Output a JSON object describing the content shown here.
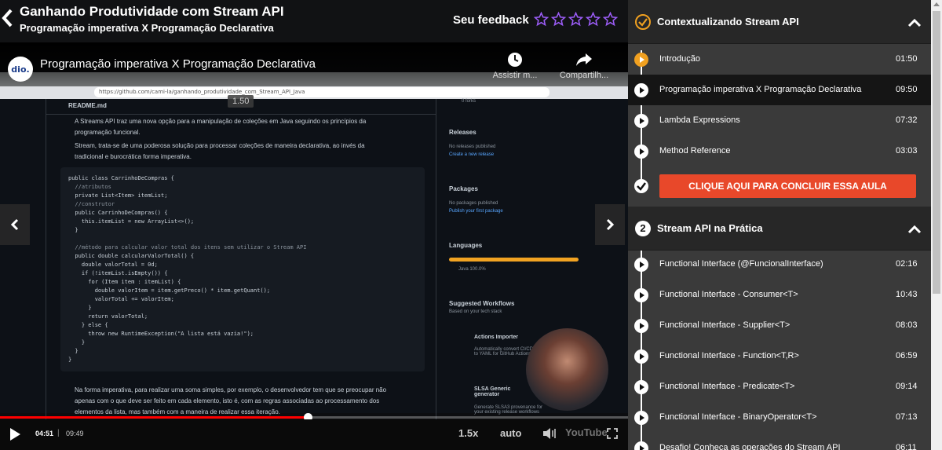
{
  "header": {
    "course_title": "Ganhando Produtividade com Stream API",
    "lesson_subtitle": "Programação imperativa X Programação Declarativa",
    "feedback_label": "Seu feedback",
    "star_count": 5,
    "accent_color": "#9b5cf6"
  },
  "player": {
    "channel_avatar_text": "dio.",
    "video_title": "Programação imperativa X Programação Declarativa",
    "watch_later_label": "Assistir m...",
    "share_label": "Compartilh...",
    "speed_badge": "1.50",
    "current_time": "04:51",
    "time_separator": "|",
    "total_time": "09:49",
    "progress": 0.49,
    "speed": "1.5x",
    "quality": "auto",
    "logo_text": "YouTube"
  },
  "screen": {
    "url": "https://github.com/cami-la/ganhando_produtividade_com_Stream_API_Java",
    "readme_name": "README.md",
    "bullets": [
      "A Streams API traz uma nova opção para a manipulação de coleções em Java seguindo os princípios da",
      "programação funcional.",
      "Stream, trata-se de uma poderosa solução para processar coleções de maneira declarativa, ao invés da",
      "tradicional e burocrática forma imperativa."
    ],
    "code": [
      "public class CarrinhoDeCompras {",
      "  //atributos",
      "  private List<Item> itemList;",
      "  //construtor",
      "  public CarrinhoDeCompras() {",
      "    this.itemList = new ArrayList<>();",
      "  }",
      "",
      "  //método para calcular valor total dos itens sem utilizar o Stream API",
      "  public double calcularValorTotal() {",
      "    double valorTotal = 0d;",
      "    if (!itemList.isEmpty()) {",
      "      for (Item item : itemList) {",
      "        double valorItem = item.getPreco() * item.getQuant();",
      "        valorTotal += valorItem;",
      "      }",
      "      return valorTotal;",
      "    } else {",
      "      throw new RuntimeException(\"A lista está vazia!\");",
      "    }",
      "  }",
      "}"
    ],
    "after_text": [
      "Na forma imperativa, para realizar uma soma simples, por exemplo, o desenvolvedor tem que se preocupar não",
      "apenas com o que deve ser feito em cada elemento, isto é, com as regras associadas ao processamento dos",
      "elementos da lista, mas também com a maneira de realizar essa iteração."
    ],
    "forks": "0 forks",
    "releases_title": "Releases",
    "releases_text": "No releases published",
    "releases_link": "Create a new release",
    "packages_title": "Packages",
    "packages_text": "No packages published",
    "packages_link": "Publish your first package",
    "languages_title": "Languages",
    "language": "Java 100.0%",
    "workflows_title": "Suggested Workflows",
    "workflows_sub": "Based on your tech stack",
    "workflow_1": "Actions Importer",
    "workflow_1_desc": "Automatically convert CI/CD files to YAML for GitHub Actions.",
    "workflow_2": "SLSA Generic generator",
    "workflow_2_desc": "Generate SLSA3 provenance for your existing release workflows"
  },
  "sidebar": {
    "section1": {
      "title": "Contextualizando Stream API",
      "lessons": [
        {
          "title": "Introdução",
          "duration": "01:50"
        },
        {
          "title": "Programação imperativa X Programação Declarativa",
          "duration": "09:50"
        },
        {
          "title": "Lambda Expressions",
          "duration": "07:32"
        },
        {
          "title": "Method Reference",
          "duration": "03:03"
        }
      ],
      "finish_label": "CLIQUE AQUI PARA CONCLUIR ESSA AULA"
    },
    "section2": {
      "number": "2",
      "title": "Stream API na Prática",
      "lessons": [
        {
          "title": "Functional Interface (@FuncionalInterface)",
          "duration": "02:16"
        },
        {
          "title": "Functional Interface - Consumer<T>",
          "duration": "10:43"
        },
        {
          "title": "Functional Interface - Supplier<T>",
          "duration": "08:03"
        },
        {
          "title": "Functional Interface - Function<T,R>",
          "duration": "06:59"
        },
        {
          "title": "Functional Interface - Predicate<T>",
          "duration": "09:14"
        },
        {
          "title": "Functional Interface - BinaryOperator<T>",
          "duration": "07:13"
        },
        {
          "title": "Desafio! Conheça as operações do Stream API",
          "duration": "06:11"
        }
      ]
    },
    "accent_color": "#f0a020",
    "button_color": "#e8482a"
  }
}
